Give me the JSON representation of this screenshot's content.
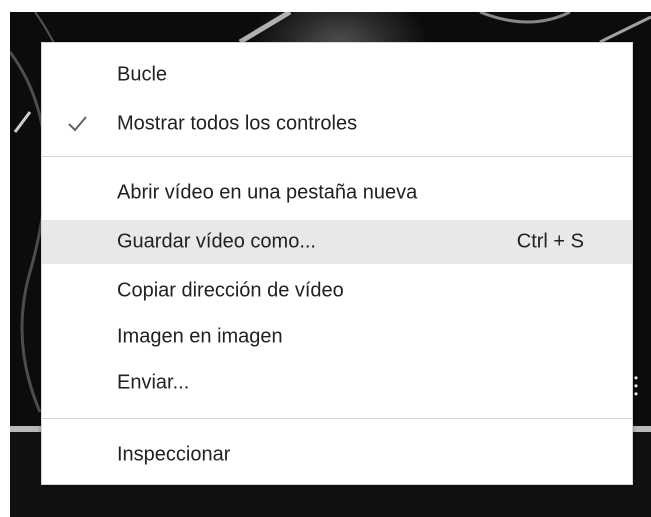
{
  "context_menu": {
    "items": [
      {
        "label": "Bucle",
        "checked": false
      },
      {
        "label": "Mostrar todos los controles",
        "checked": true
      },
      {
        "label": "Abrir vídeo en una pestaña nueva",
        "checked": false
      },
      {
        "label": "Guardar vídeo como...",
        "shortcut": "Ctrl + S",
        "highlighted": true
      },
      {
        "label": "Copiar dirección de vídeo",
        "checked": false
      },
      {
        "label": "Imagen en imagen",
        "checked": false
      },
      {
        "label": "Enviar...",
        "checked": false
      },
      {
        "label": "Inspeccionar",
        "checked": false
      }
    ],
    "check_icon": "checkmark-icon",
    "highlight_color": "#e8e8e9",
    "text_color": "#202124"
  },
  "video": {
    "more_icon": "vertical-dots-icon"
  }
}
